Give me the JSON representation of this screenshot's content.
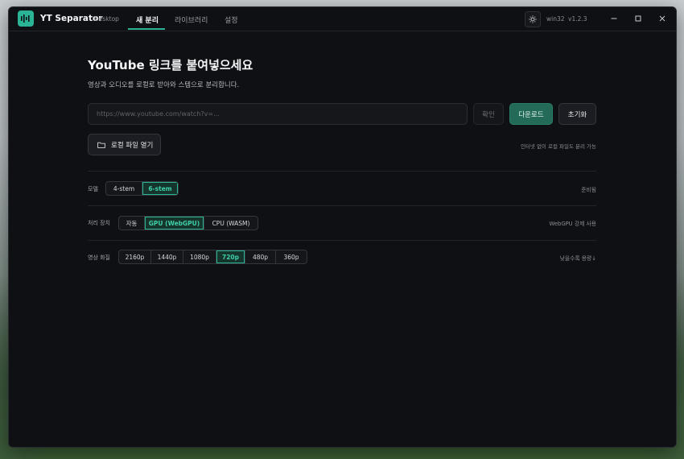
{
  "app": {
    "title": "YT Separator",
    "subtitle": "Desktop",
    "platform": "win32",
    "version": "v1.2.3",
    "accent": "#2bb396"
  },
  "nav": {
    "tabs": [
      {
        "label": "새 분리",
        "active": true
      },
      {
        "label": "라이브러리",
        "active": false
      },
      {
        "label": "설정",
        "active": false
      }
    ]
  },
  "window_controls": {
    "minimize": "—",
    "maximize": "☐",
    "close": "✕"
  },
  "hero": {
    "title": "YouTube 링크를 붙여넣으세요",
    "subtitle": "영상과 오디오를 로컬로 받아와 스템으로 분리합니다."
  },
  "url_input": {
    "value": "",
    "placeholder": "https://www.youtube.com/watch?v=..."
  },
  "buttons": {
    "confirm": "확인",
    "download": "다운로드",
    "reset": "초기화",
    "open_local": "로컬 파일 열기"
  },
  "offline_note": "인터넷 없이 로컬 파일도 분리 가능",
  "model": {
    "label": "모델",
    "options": [
      "4-stem",
      "6-stem"
    ],
    "selected": "6-stem",
    "status": "준비됨"
  },
  "device": {
    "label": "처리 장치",
    "options": [
      "자동",
      "GPU (WebGPU)",
      "CPU (WASM)"
    ],
    "selected": "GPU (WebGPU)",
    "note": "WebGPU 강제 사용"
  },
  "quality": {
    "label": "영상 화질",
    "options": [
      "2160p",
      "1440p",
      "1080p",
      "720p",
      "480p",
      "360p"
    ],
    "selected": "720p",
    "note": "낮을수록 용량↓"
  },
  "icons": {
    "logo": "waveform-icon",
    "theme": "sun-icon",
    "folder": "folder-icon"
  }
}
